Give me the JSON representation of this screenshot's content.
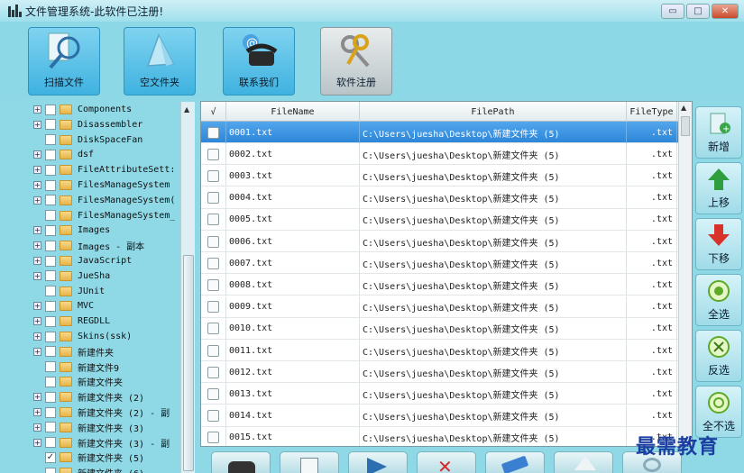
{
  "window": {
    "title": "文件管理系统-此软件已注册!",
    "controls": [
      "minimize",
      "maximize",
      "close"
    ]
  },
  "toolbar": [
    {
      "label": "扫描文件",
      "icon": "scan-magnifier-icon",
      "style": "cyan"
    },
    {
      "label": "空文件夹",
      "icon": "empty-folder-icon",
      "style": "cyan"
    },
    {
      "label": "联系我们",
      "icon": "phone-icon",
      "style": "cyan"
    },
    {
      "label": "软件注册",
      "icon": "key-icon",
      "style": "grey"
    }
  ],
  "tree": {
    "items": [
      {
        "label": "Components",
        "expand": true,
        "checked": false
      },
      {
        "label": "Disassembler",
        "expand": true,
        "checked": false
      },
      {
        "label": "DiskSpaceFan",
        "expand": false,
        "checked": false
      },
      {
        "label": "dsf",
        "expand": true,
        "checked": false
      },
      {
        "label": "FileAttributeSett:",
        "expand": true,
        "checked": false
      },
      {
        "label": "FilesManageSystem",
        "expand": true,
        "checked": false
      },
      {
        "label": "FilesManageSystem(",
        "expand": true,
        "checked": false
      },
      {
        "label": "FilesManageSystem_",
        "expand": false,
        "checked": false
      },
      {
        "label": "Images",
        "expand": true,
        "checked": false
      },
      {
        "label": "Images - 副本",
        "expand": true,
        "checked": false
      },
      {
        "label": "JavaScript",
        "expand": true,
        "checked": false
      },
      {
        "label": "JueSha",
        "expand": true,
        "checked": false
      },
      {
        "label": "JUnit",
        "expand": false,
        "checked": false
      },
      {
        "label": "MVC",
        "expand": true,
        "checked": false
      },
      {
        "label": "REGDLL",
        "expand": true,
        "checked": false
      },
      {
        "label": "Skins(ssk)",
        "expand": true,
        "checked": false
      },
      {
        "label": "新建件夹",
        "expand": true,
        "checked": false
      },
      {
        "label": "新建文件9",
        "expand": false,
        "checked": false
      },
      {
        "label": "新建文件夹",
        "expand": false,
        "checked": false
      },
      {
        "label": "新建文件夹 (2)",
        "expand": true,
        "checked": false
      },
      {
        "label": "新建文件夹 (2) - 副",
        "expand": true,
        "checked": false
      },
      {
        "label": "新建文件夹 (3)",
        "expand": true,
        "checked": false
      },
      {
        "label": "新建文件夹 (3) - 副",
        "expand": true,
        "checked": false
      },
      {
        "label": "新建文件夹 (5)",
        "expand": false,
        "checked": true
      },
      {
        "label": "新建文件夹 (6)",
        "expand": false,
        "checked": false
      }
    ]
  },
  "table": {
    "headers": {
      "check": "√",
      "name": "FileName",
      "path": "FilePath",
      "type": "FileType"
    },
    "rows": [
      {
        "name": "0001.txt",
        "path": "C:\\Users\\juesha\\Desktop\\新建文件夹 (5)",
        "type": ".txt",
        "selected": true
      },
      {
        "name": "0002.txt",
        "path": "C:\\Users\\juesha\\Desktop\\新建文件夹 (5)",
        "type": ".txt",
        "selected": false
      },
      {
        "name": "0003.txt",
        "path": "C:\\Users\\juesha\\Desktop\\新建文件夹 (5)",
        "type": ".txt",
        "selected": false
      },
      {
        "name": "0004.txt",
        "path": "C:\\Users\\juesha\\Desktop\\新建文件夹 (5)",
        "type": ".txt",
        "selected": false
      },
      {
        "name": "0005.txt",
        "path": "C:\\Users\\juesha\\Desktop\\新建文件夹 (5)",
        "type": ".txt",
        "selected": false
      },
      {
        "name": "0006.txt",
        "path": "C:\\Users\\juesha\\Desktop\\新建文件夹 (5)",
        "type": ".txt",
        "selected": false
      },
      {
        "name": "0007.txt",
        "path": "C:\\Users\\juesha\\Desktop\\新建文件夹 (5)",
        "type": ".txt",
        "selected": false
      },
      {
        "name": "0008.txt",
        "path": "C:\\Users\\juesha\\Desktop\\新建文件夹 (5)",
        "type": ".txt",
        "selected": false
      },
      {
        "name": "0009.txt",
        "path": "C:\\Users\\juesha\\Desktop\\新建文件夹 (5)",
        "type": ".txt",
        "selected": false
      },
      {
        "name": "0010.txt",
        "path": "C:\\Users\\juesha\\Desktop\\新建文件夹 (5)",
        "type": ".txt",
        "selected": false
      },
      {
        "name": "0011.txt",
        "path": "C:\\Users\\juesha\\Desktop\\新建文件夹 (5)",
        "type": ".txt",
        "selected": false
      },
      {
        "name": "0012.txt",
        "path": "C:\\Users\\juesha\\Desktop\\新建文件夹 (5)",
        "type": ".txt",
        "selected": false
      },
      {
        "name": "0013.txt",
        "path": "C:\\Users\\juesha\\Desktop\\新建文件夹 (5)",
        "type": ".txt",
        "selected": false
      },
      {
        "name": "0014.txt",
        "path": "C:\\Users\\juesha\\Desktop\\新建文件夹 (5)",
        "type": ".txt",
        "selected": false
      },
      {
        "name": "0015.txt",
        "path": "C:\\Users\\juesha\\Desktop\\新建文件夹 (5)",
        "type": ".txt",
        "selected": false
      }
    ]
  },
  "side_buttons": [
    {
      "label": "新增",
      "icon": "add-file-icon"
    },
    {
      "label": "上移",
      "icon": "arrow-up-icon"
    },
    {
      "label": "下移",
      "icon": "arrow-down-icon"
    },
    {
      "label": "全选",
      "icon": "select-all-icon"
    },
    {
      "label": "反选",
      "icon": "invert-select-icon"
    },
    {
      "label": "全不选",
      "icon": "select-none-icon"
    }
  ],
  "bottom_buttons": [
    {
      "icon": "binoculars-icon"
    },
    {
      "icon": "export-icon"
    },
    {
      "icon": "move-icon"
    },
    {
      "icon": "delete-icon"
    },
    {
      "icon": "eraser-icon"
    },
    {
      "icon": "upload-icon"
    },
    {
      "icon": "refresh-icon"
    }
  ],
  "watermark": "最需教育",
  "colors": {
    "accent": "#2d86d9",
    "background": "#8fd8e6"
  }
}
